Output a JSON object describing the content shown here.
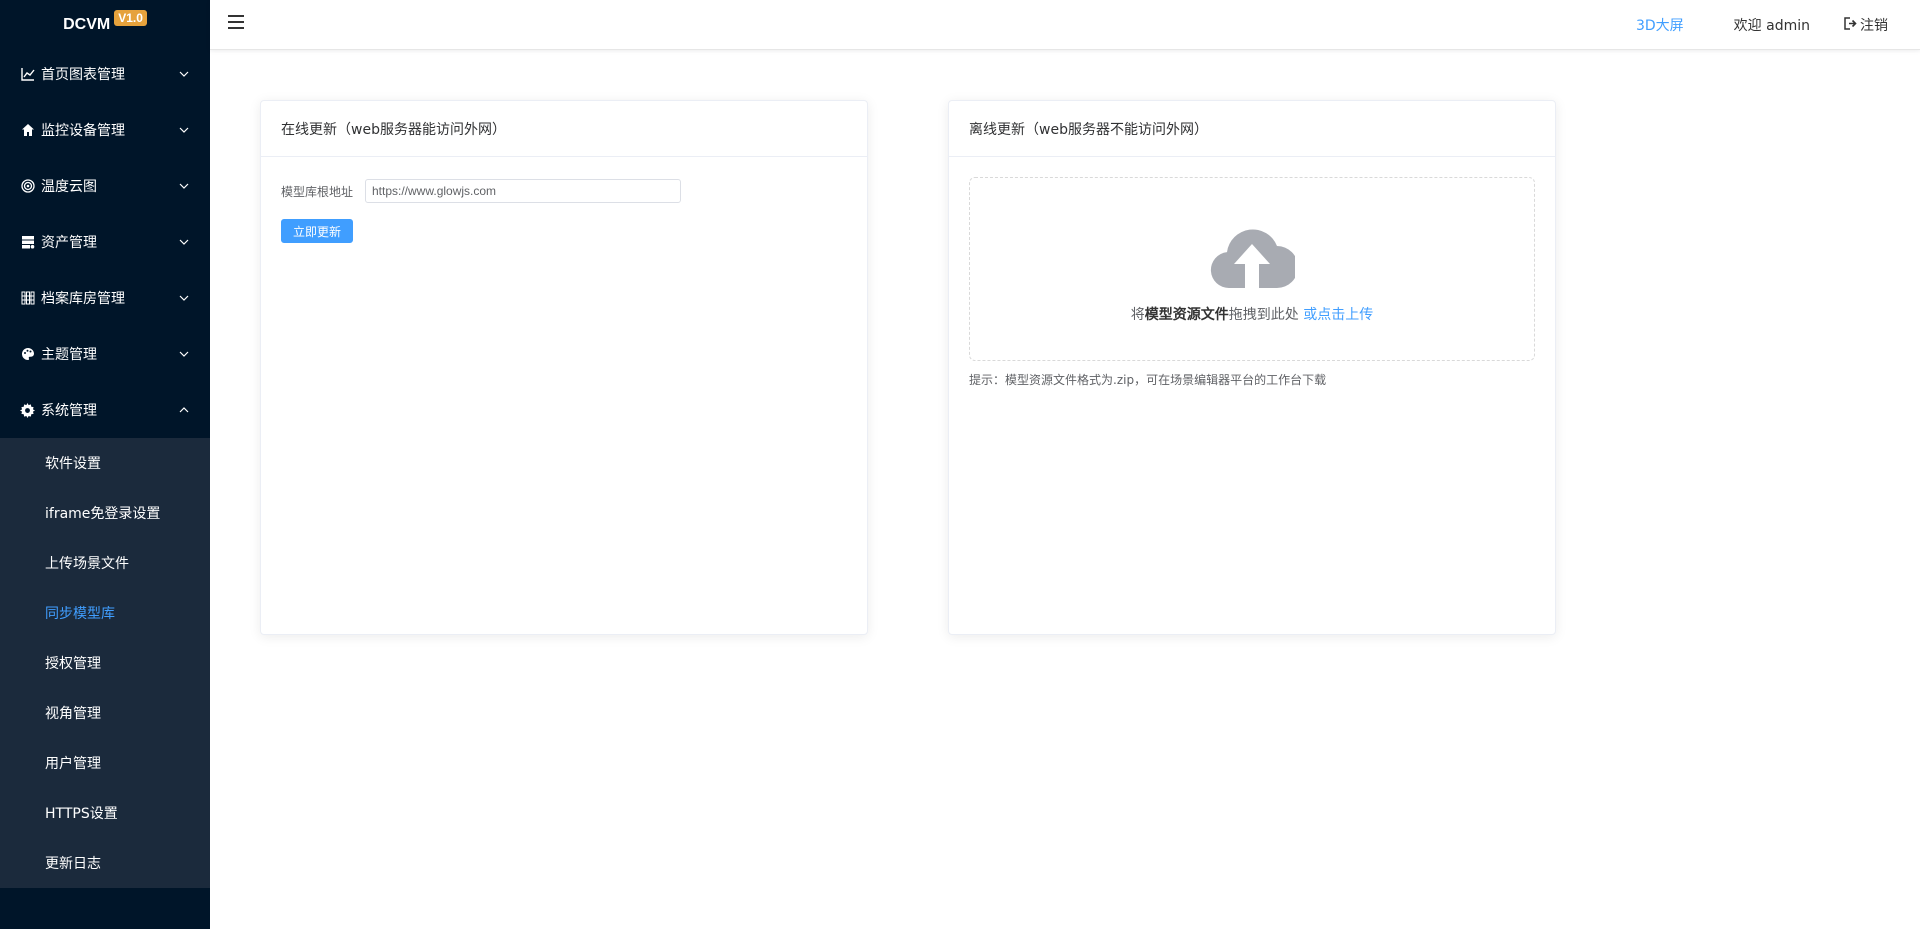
{
  "brand": {
    "name": "DCVM",
    "version": "V1.0"
  },
  "sidebar": {
    "groups": [
      {
        "label": "首页图表管理",
        "icon": "line-chart-icon",
        "expanded": false
      },
      {
        "label": "监控设备管理",
        "icon": "home-icon",
        "expanded": false
      },
      {
        "label": "温度云图",
        "icon": "target-icon",
        "expanded": false
      },
      {
        "label": "资产管理",
        "icon": "server-icon",
        "expanded": false
      },
      {
        "label": "档案库房管理",
        "icon": "grid-icon",
        "expanded": false
      },
      {
        "label": "主题管理",
        "icon": "palette-icon",
        "expanded": false
      },
      {
        "label": "系统管理",
        "icon": "gear-icon",
        "expanded": true
      }
    ],
    "system_items": [
      {
        "label": "软件设置",
        "active": false
      },
      {
        "label": "iframe免登录设置",
        "active": false
      },
      {
        "label": "上传场景文件",
        "active": false
      },
      {
        "label": "同步模型库",
        "active": true
      },
      {
        "label": "授权管理",
        "active": false
      },
      {
        "label": "视角管理",
        "active": false
      },
      {
        "label": "用户管理",
        "active": false
      },
      {
        "label": "HTTPS设置",
        "active": false
      },
      {
        "label": "更新日志",
        "active": false
      }
    ]
  },
  "header": {
    "link_3d": "3D大屏",
    "welcome": "欢迎 admin",
    "logout": "注销"
  },
  "online": {
    "title": "在线更新（web服务器能访问外网）",
    "field_label": "模型库根地址",
    "field_value": "https://www.glowjs.com",
    "button": "立即更新"
  },
  "offline": {
    "title": "离线更新（web服务器不能访问外网）",
    "upload_prefix": "将",
    "upload_emphasis": "模型资源文件",
    "upload_middle": "拖拽到此处",
    "upload_link": "或点击上传",
    "tip": "提示：模型资源文件格式为.zip，可在场景编辑器平台的工作台下载"
  },
  "colors": {
    "sidebar_bg": "#001529",
    "submenu_bg": "#1b2a3c",
    "accent": "#409eff",
    "badge": "#e6a23c"
  }
}
